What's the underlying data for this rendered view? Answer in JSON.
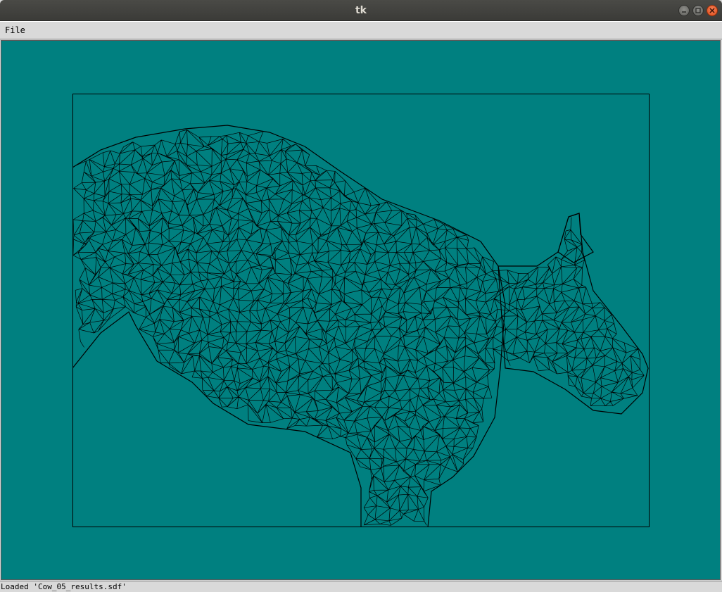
{
  "window": {
    "title": "tk"
  },
  "menubar": {
    "items": [
      {
        "label": "File"
      }
    ]
  },
  "canvas": {
    "background_color": "#008080",
    "model_description_icon": "cow-wireframe-mesh",
    "line_color": "#000000"
  },
  "statusbar": {
    "text": "Loaded 'Cow_05_results.sdf'"
  },
  "colors": {
    "titlebar": "#3c3b37",
    "close_button": "#e95420",
    "chrome": "#d9d9d9"
  }
}
